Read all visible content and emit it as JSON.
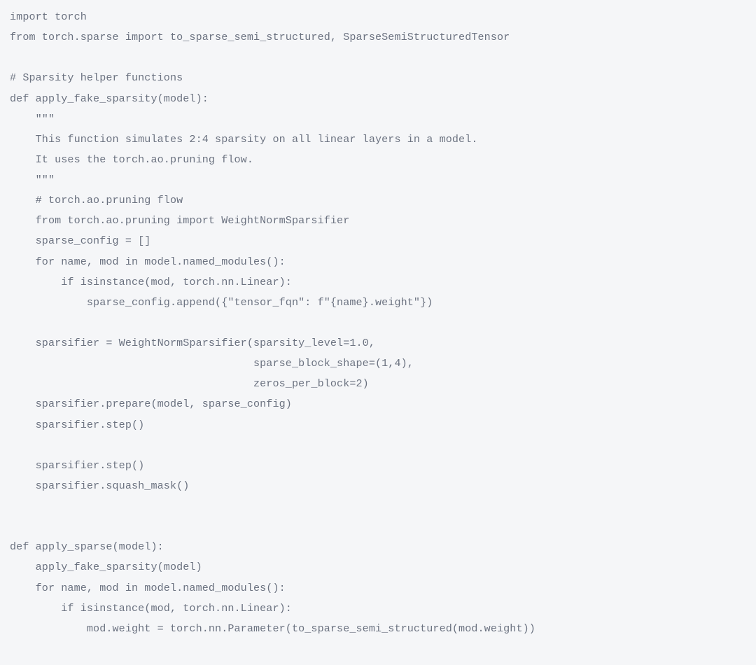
{
  "code": {
    "lines": [
      "import torch",
      "from torch.sparse import to_sparse_semi_structured, SparseSemiStructuredTensor",
      "",
      "# Sparsity helper functions",
      "def apply_fake_sparsity(model):",
      "    \"\"\"",
      "    This function simulates 2:4 sparsity on all linear layers in a model.",
      "    It uses the torch.ao.pruning flow.",
      "    \"\"\"",
      "    # torch.ao.pruning flow",
      "    from torch.ao.pruning import WeightNormSparsifier",
      "    sparse_config = []",
      "    for name, mod in model.named_modules():",
      "        if isinstance(mod, torch.nn.Linear):",
      "            sparse_config.append({\"tensor_fqn\": f\"{name}.weight\"})",
      "",
      "    sparsifier = WeightNormSparsifier(sparsity_level=1.0,",
      "                                      sparse_block_shape=(1,4),",
      "                                      zeros_per_block=2)",
      "    sparsifier.prepare(model, sparse_config)",
      "    sparsifier.step()",
      "",
      "    sparsifier.step()",
      "    sparsifier.squash_mask()",
      "",
      "",
      "def apply_sparse(model):",
      "    apply_fake_sparsity(model)",
      "    for name, mod in model.named_modules():",
      "        if isinstance(mod, torch.nn.Linear):",
      "            mod.weight = torch.nn.Parameter(to_sparse_semi_structured(mod.weight))"
    ]
  }
}
